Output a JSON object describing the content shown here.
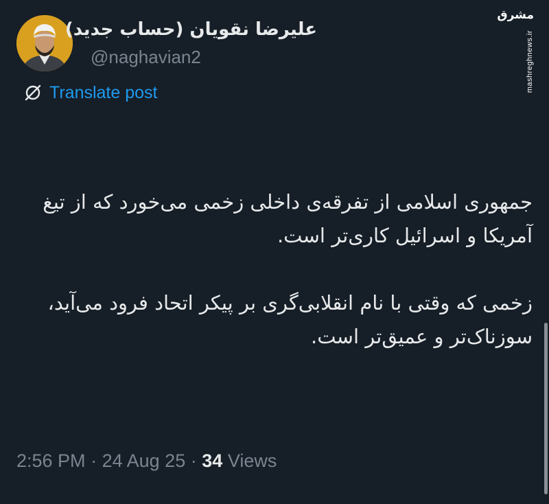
{
  "tweet": {
    "author": {
      "display_name": "علیرضا نقویان (حساب جدید)",
      "handle": "@naghavian2"
    },
    "translate_label": "Translate post",
    "text_paragraph_1": "جمهوری اسلامی از تفرقه‌ی داخلی زخمی می‌خورد که از تیغ آمریکا و اسرائیل کاری‌تر است.",
    "text_paragraph_2": "زخمی که وقتی با نام انقلابی‌گری بر پیکر اتحاد فرود می‌آید، سوزناک‌تر و عمیق‌تر است.",
    "meta": {
      "time": "2:56 PM",
      "separator": "·",
      "date": "24 Aug 25",
      "views_count": "34",
      "views_label": "Views"
    }
  },
  "watermark": {
    "logo": "مشرق",
    "site": "mashreghnews.ir"
  },
  "colors": {
    "background": "#161e27",
    "text": "#e7e9ea",
    "muted": "#7a8590",
    "link": "#1d9bf0",
    "avatar_bg": "#d9a020"
  },
  "icons": {
    "translate": "globe-slash-icon"
  }
}
